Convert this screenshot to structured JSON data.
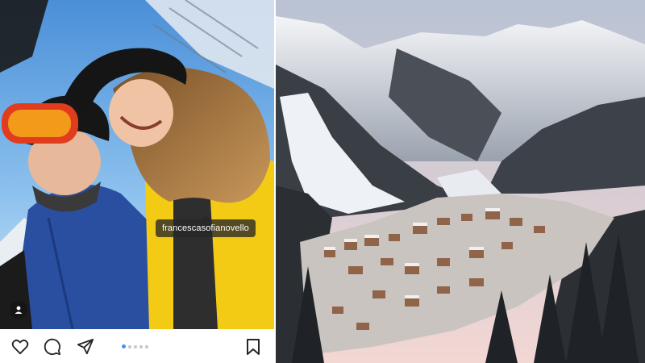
{
  "post": {
    "tagged_user": "francescasofianovello",
    "carousel": {
      "total_slides": 5,
      "active_slide": 1
    }
  },
  "actions": {
    "like": "heart-icon",
    "comment": "comment-icon",
    "share": "send-icon",
    "save": "bookmark-icon"
  },
  "colors": {
    "accent": "#3897f0",
    "icon": "#262626",
    "jacket_yellow": "#f4cb14",
    "jacket_blue": "#2a4fa0"
  }
}
